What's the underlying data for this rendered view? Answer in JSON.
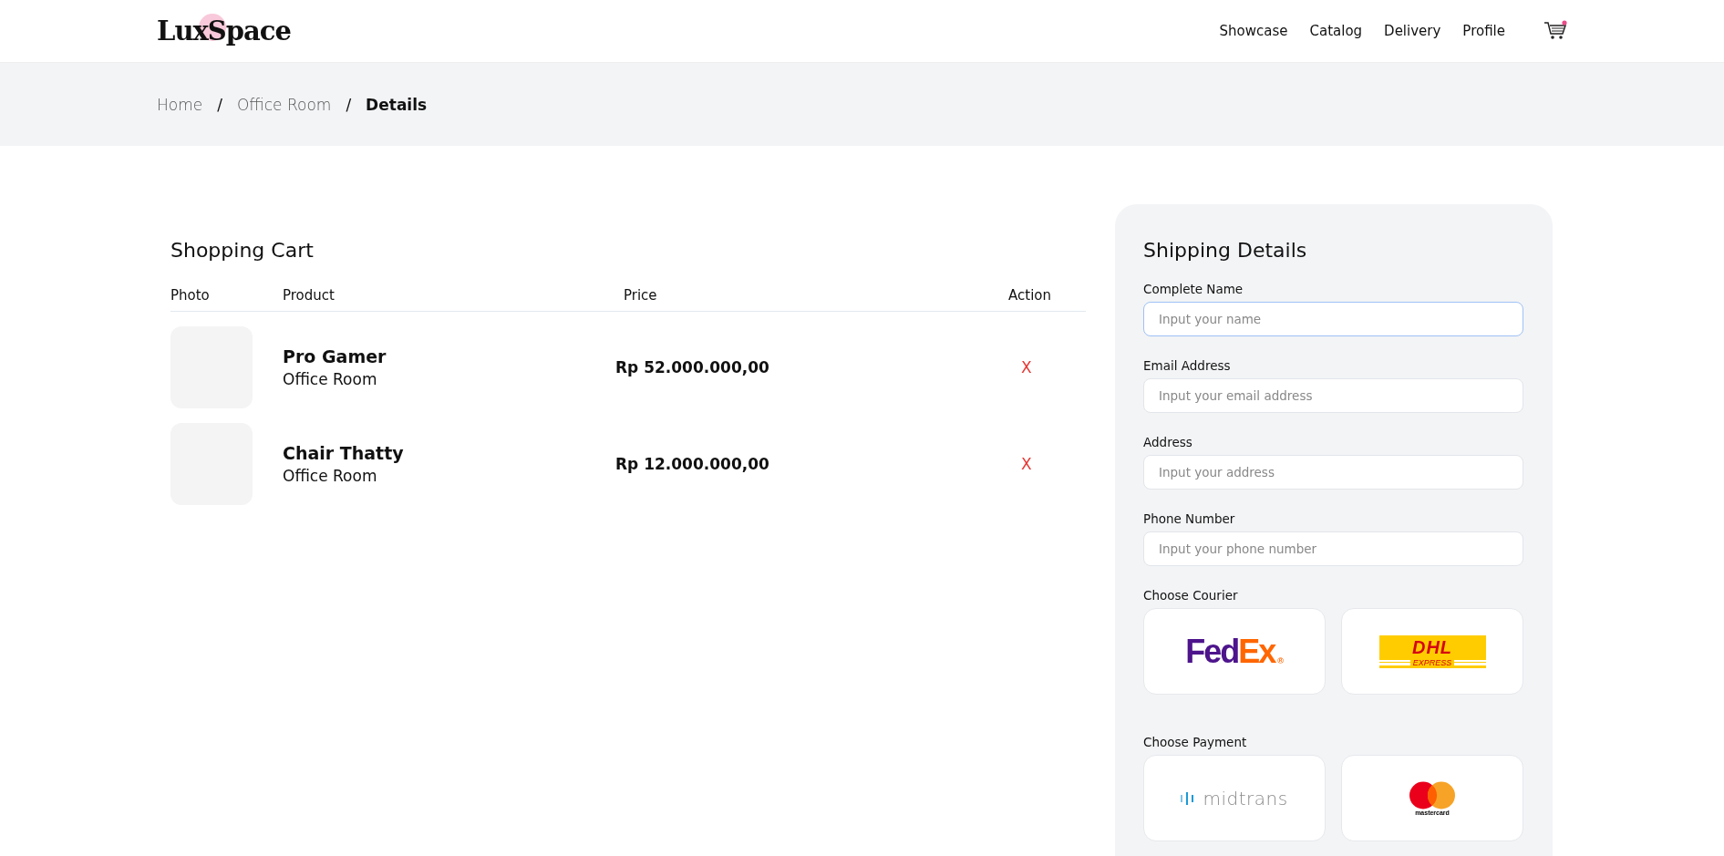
{
  "header": {
    "logo": "LuxSpace",
    "nav": [
      "Showcase",
      "Catalog",
      "Delivery",
      "Profile"
    ],
    "cart_badge": true
  },
  "breadcrumb_separator": "/",
  "breadcrumb": [
    {
      "label": "Home",
      "selected": false
    },
    {
      "label": "Office Room",
      "selected": false
    },
    {
      "label": "Details",
      "selected": true
    }
  ],
  "cart": {
    "title": "Shopping Cart",
    "columns": [
      "Photo",
      "Product",
      "Price",
      "Action"
    ],
    "rows": [
      {
        "name": "Pro Gamer",
        "category": "Office Room",
        "price": "Rp 52.000.000,00",
        "action": "X"
      },
      {
        "name": "Chair Thatty",
        "category": "Office Room",
        "price": "Rp 12.000.000,00",
        "action": "X"
      }
    ]
  },
  "shipping": {
    "title": "Shipping Details",
    "fields": [
      {
        "label": "Complete Name",
        "placeholder": "Input your name",
        "focused": true
      },
      {
        "label": "Email Address",
        "placeholder": "Input your email address",
        "focused": false
      },
      {
        "label": "Address",
        "placeholder": "Input your address",
        "focused": false
      },
      {
        "label": "Phone Number",
        "placeholder": "Input your phone number",
        "focused": false
      }
    ],
    "courier_label": "Choose Courier",
    "couriers": [
      {
        "kind": "fedex",
        "logo": [
          "Fed",
          "Ex"
        ],
        "mark": "®"
      },
      {
        "kind": "dhl",
        "logo": [
          "DHL"
        ],
        "mark": "EXPRESS"
      }
    ],
    "payment_label": "Choose Payment",
    "payments": [
      {
        "kind": "midtrans",
        "logo": [
          "midtrans"
        ]
      },
      {
        "kind": "mastercard",
        "logo": [
          "mastercard"
        ]
      }
    ]
  }
}
